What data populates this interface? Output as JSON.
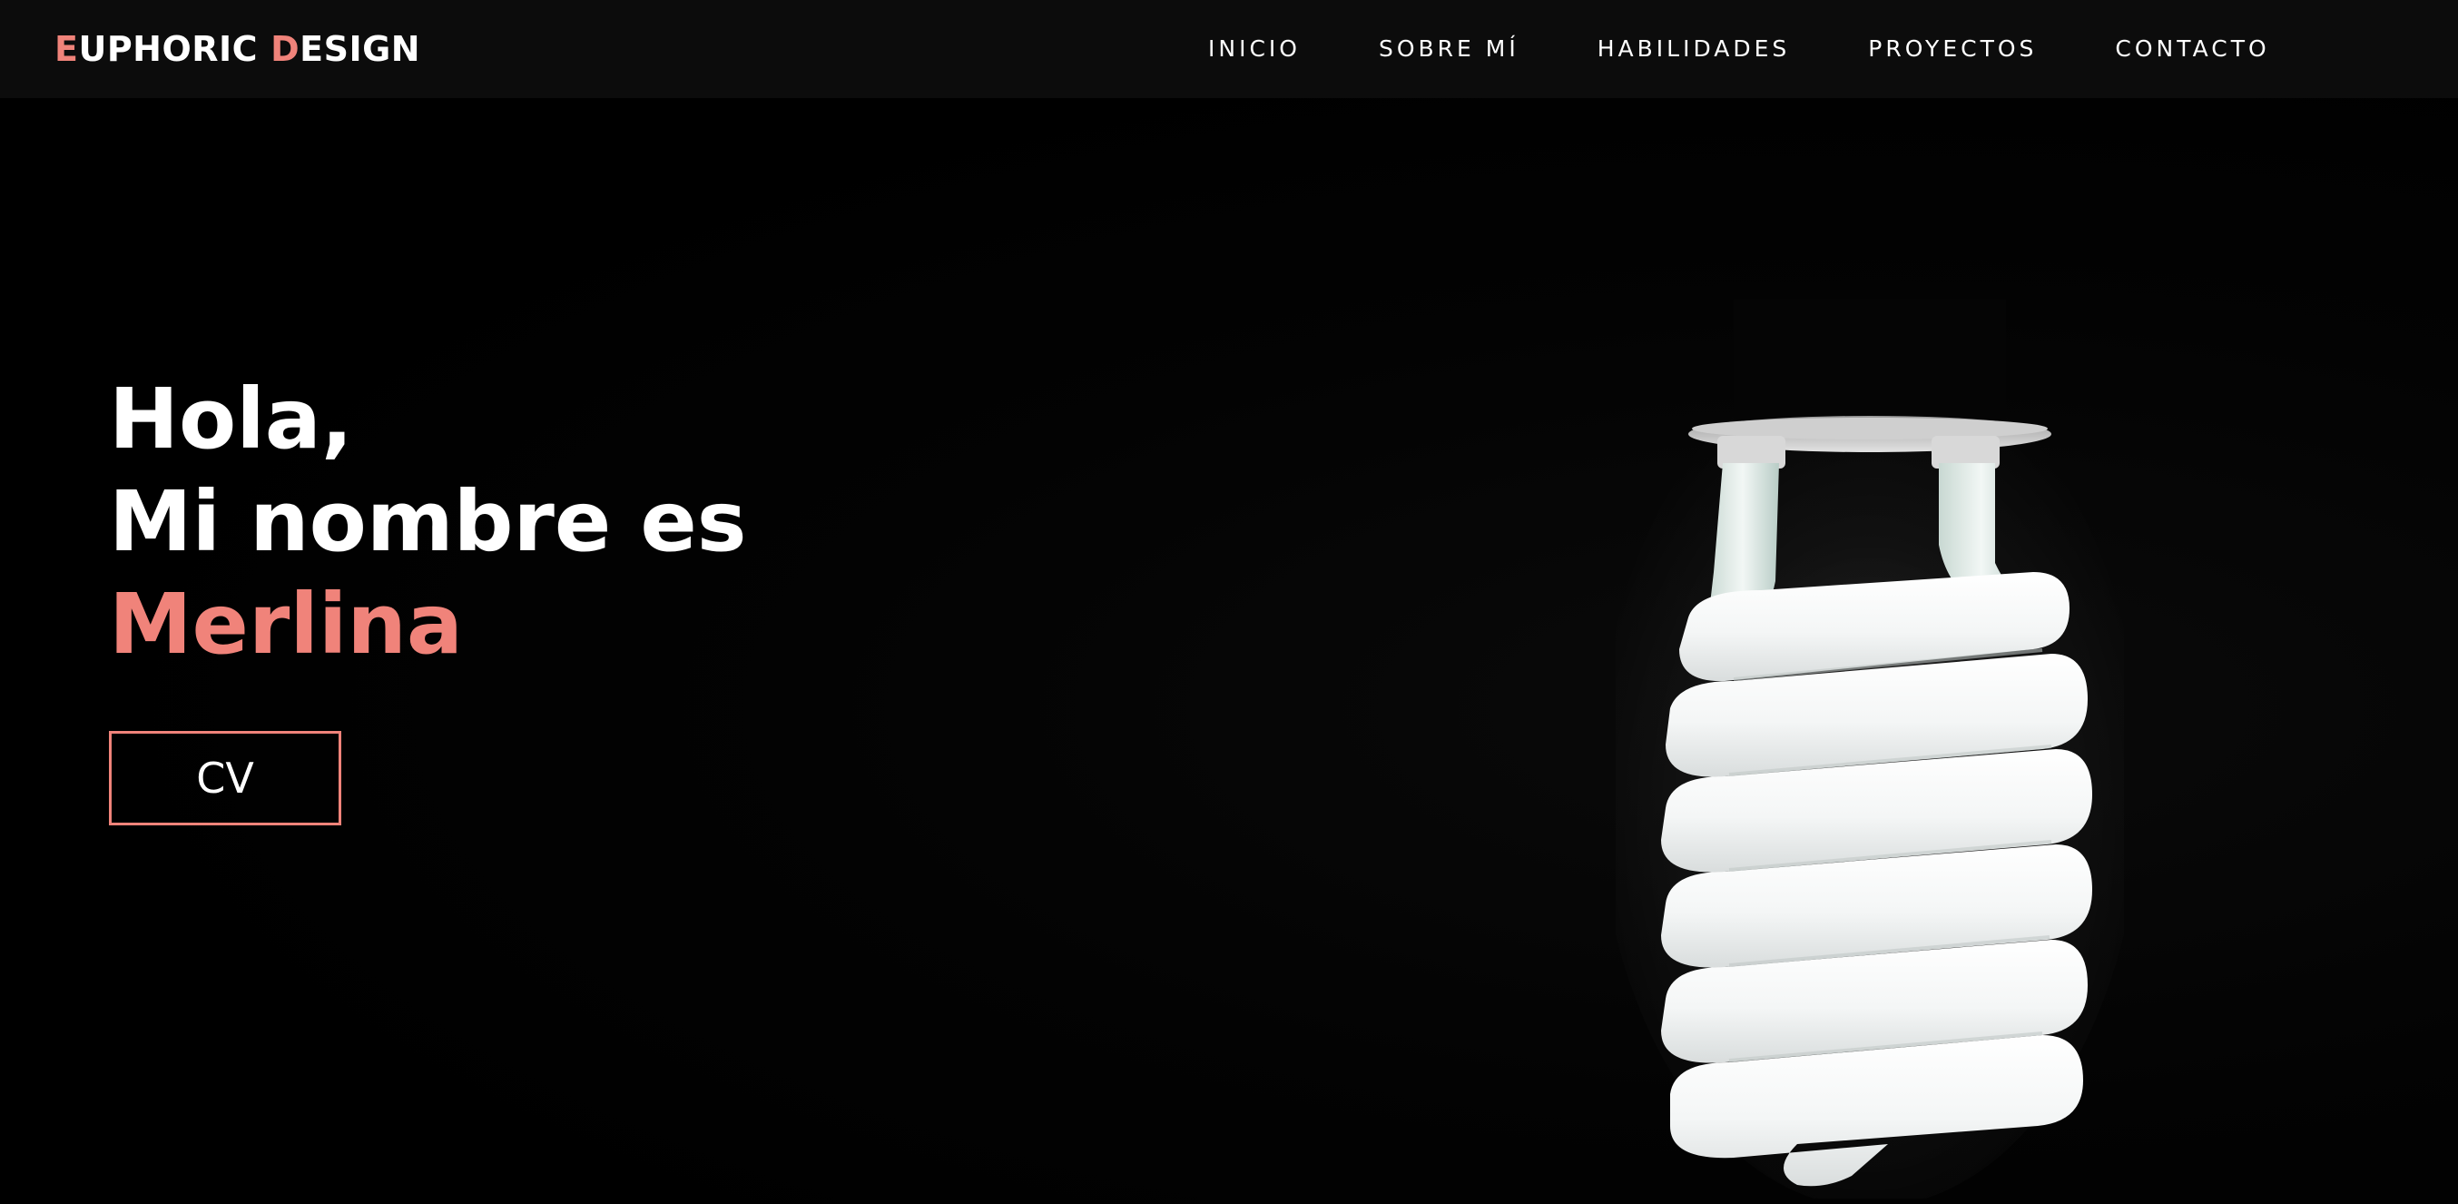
{
  "brand": {
    "first_initial": "E",
    "first_rest": "UPHORIC",
    "second_initial": "D",
    "second_rest": "ESIGN"
  },
  "nav": {
    "items": [
      {
        "label": "INICIO"
      },
      {
        "label": "SOBRE MÍ"
      },
      {
        "label": "HABILIDADES"
      },
      {
        "label": "PROYECTOS"
      },
      {
        "label": "CONTACTO"
      }
    ]
  },
  "hero": {
    "greeting": "Hola,",
    "intro": "Mi nombre es",
    "name": "Merlina",
    "cv_label": "CV",
    "image_icon": "lightbulb-image"
  },
  "colors": {
    "accent": "#f0837a",
    "background": "#000000",
    "navbar": "#0c0c0c",
    "text": "#ffffff"
  }
}
